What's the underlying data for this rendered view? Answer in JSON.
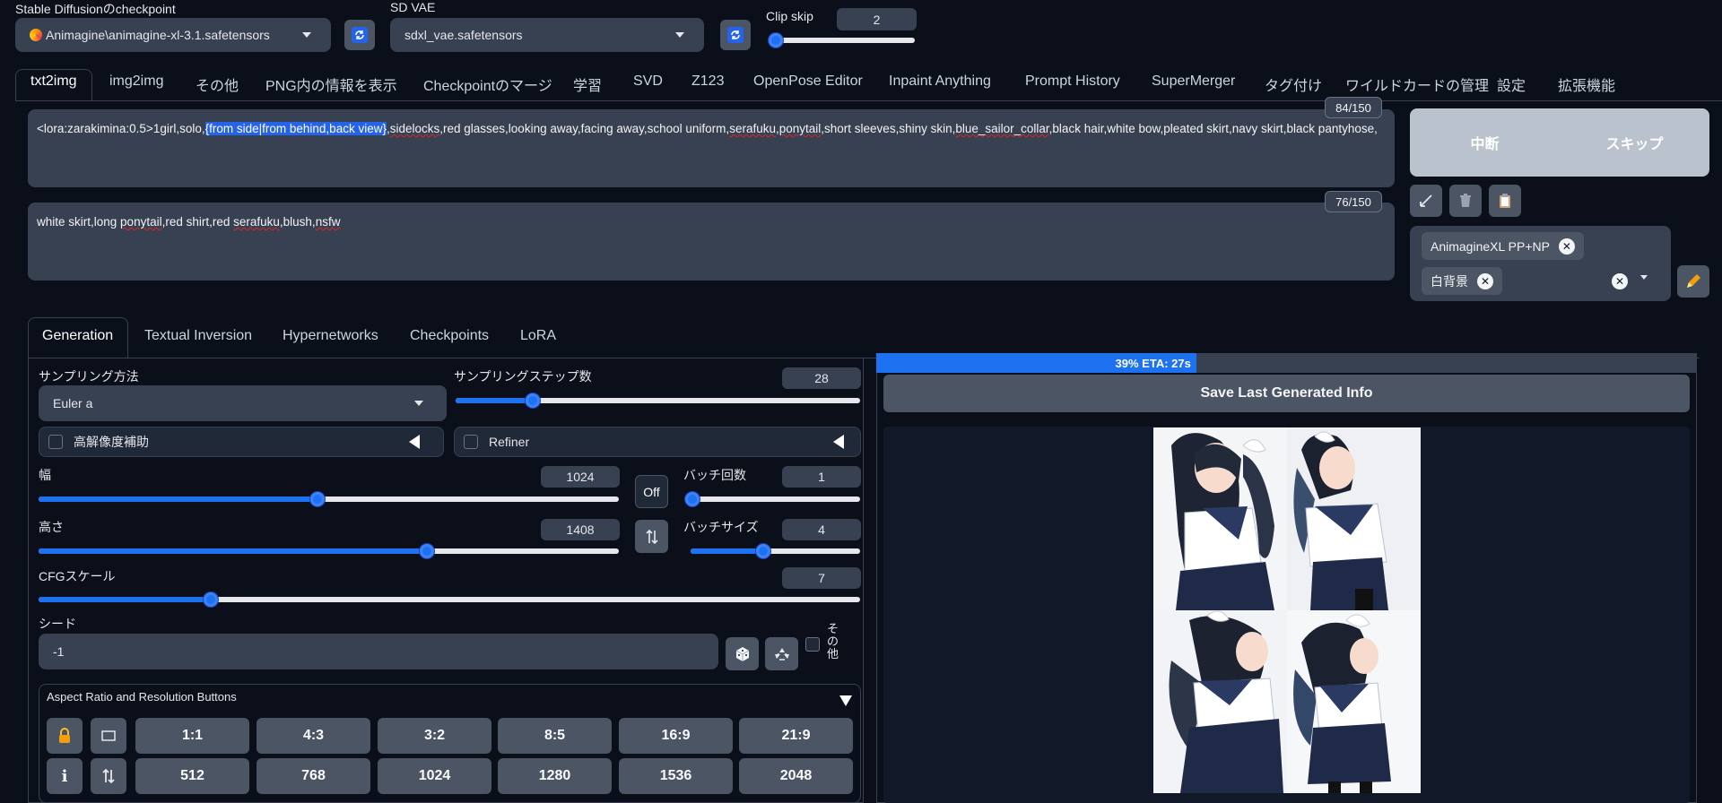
{
  "checkpoint": {
    "label": "Stable Diffusionのcheckpoint",
    "value": "Animagine\\animagine-xl-3.1.safetensors",
    "icon": "colorful-emoji-icon"
  },
  "vae": {
    "label": "SD VAE",
    "value": "sdxl_vae.safetensors"
  },
  "clip_skip": {
    "label": "Clip skip",
    "value": "2",
    "fraction": 0.02
  },
  "tabs": [
    "txt2img",
    "img2img",
    "その他",
    "PNG内の情報を表示",
    "Checkpointのマージ",
    "学習",
    "SVD",
    "Z123",
    "OpenPose Editor",
    "Inpaint Anything",
    "Prompt History",
    "SuperMerger",
    "タグ付け",
    "ワイルドカードの管理",
    "設定",
    "拡張機能"
  ],
  "active_tab": "txt2img",
  "prompt": {
    "before": "<lora:zarakimina:0.5>1girl,solo,",
    "selected": "{from side|from behind,back view}",
    "after_parts": [
      ",",
      "sidelocks",
      ",red glasses,looking away,facing away,school uniform,",
      "serafuku",
      ",",
      "ponytail",
      ",short sleeves,shiny skin,",
      "blue_sailor_collar",
      ",black hair,white bow,pleated skirt,navy skirt,black pantyhose,"
    ],
    "counter": "84/150"
  },
  "negative": {
    "parts": [
      "white skirt,long ",
      "ponytail",
      ",red shirt,red ",
      "serafuku",
      ",blush,",
      "nsfw"
    ],
    "counter": "76/150"
  },
  "actions": {
    "interrupt": "中断",
    "skip": "スキップ"
  },
  "styles": {
    "chips": [
      "AnimagineXL PP+NP",
      "白背景"
    ]
  },
  "subtabs": [
    "Generation",
    "Textual Inversion",
    "Hypernetworks",
    "Checkpoints",
    "LoRA"
  ],
  "sampling": {
    "method_label": "サンプリング方法",
    "method": "Euler a",
    "steps_label": "サンプリングステップ数",
    "steps": "28",
    "steps_fraction": 0.19
  },
  "hires": {
    "label": "高解像度補助"
  },
  "refiner": {
    "label": "Refiner"
  },
  "width": {
    "label": "幅",
    "value": "1024",
    "fraction": 0.48
  },
  "height": {
    "label": "高さ",
    "value": "1408",
    "fraction": 0.67
  },
  "batch_count": {
    "label": "バッチ回数",
    "value": "1",
    "fraction": 0.01
  },
  "batch_size": {
    "label": "バッチサイズ",
    "value": "4",
    "fraction": 0.43
  },
  "off_button": "Off",
  "cfg": {
    "label": "CFGスケール",
    "value": "7",
    "fraction": 0.21
  },
  "seed": {
    "label": "シード",
    "value": "-1",
    "extra_label": "その他"
  },
  "aspect": {
    "title": "Aspect Ratio and Resolution Buttons",
    "ratios": [
      "1:1",
      "4:3",
      "3:2",
      "8:5",
      "16:9",
      "21:9"
    ],
    "sizes": [
      "512",
      "768",
      "1024",
      "1280",
      "1536",
      "2048"
    ]
  },
  "progress": {
    "text": "39% ETA: 27s",
    "fraction": 0.39
  },
  "save_info": "Save Last Generated Info",
  "colors": {
    "accent": "#1d72f2",
    "bg": "#0b0f19",
    "panel": "#1f2937"
  }
}
